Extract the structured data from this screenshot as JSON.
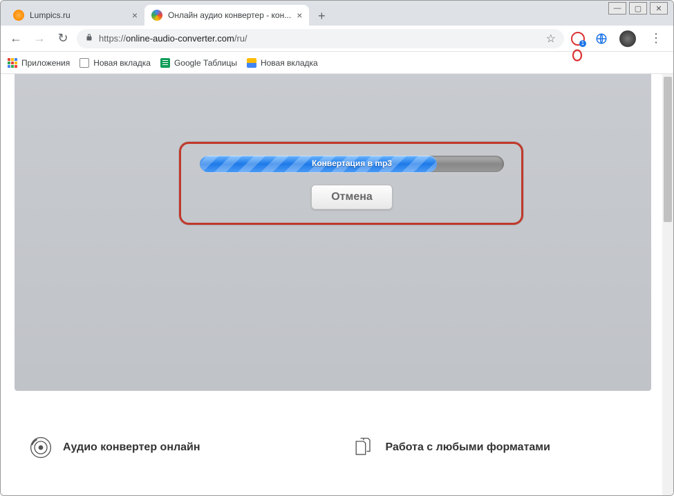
{
  "window_controls": {
    "min": "—",
    "max": "▢",
    "close": "✕"
  },
  "tabs": [
    {
      "title": "Lumpics.ru",
      "close": "×"
    },
    {
      "title": "Онлайн аудио конвертер - кон...",
      "close": "×"
    }
  ],
  "new_tab": "+",
  "nav": {
    "back": "←",
    "forward": "→",
    "reload": "↻"
  },
  "url": {
    "prefix": "https://",
    "host": "online-audio-converter.com",
    "path": "/ru/"
  },
  "bookmarks": {
    "apps": "Приложения",
    "items": [
      {
        "label": "Новая вкладка"
      },
      {
        "label": "Google Таблицы"
      },
      {
        "label": "Новая вкладка"
      }
    ]
  },
  "progress": {
    "label": "Конвертация в mp3",
    "percent": 78
  },
  "cancel_label": "Отмена",
  "features": [
    {
      "title": "Аудио конвертер онлайн"
    },
    {
      "title": "Работа с любыми форматами"
    }
  ],
  "ext_badge": "1",
  "menu": "⋮"
}
